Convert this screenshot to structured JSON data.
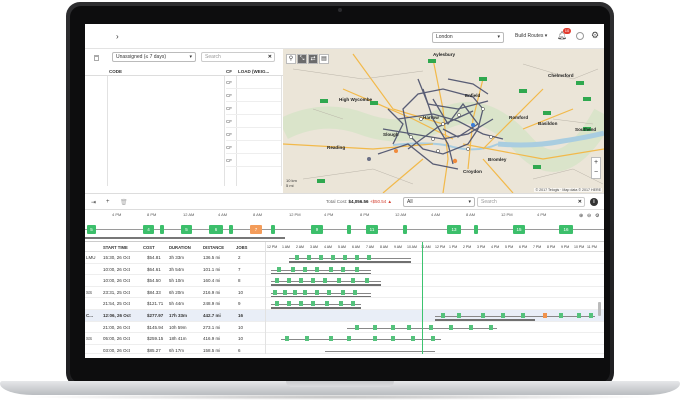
{
  "topbar": {
    "nav_arrow": "›",
    "city": "London",
    "build_routes": "Build Routes",
    "notifications": "10"
  },
  "left_panel": {
    "filter": "Unassigned (≤ 7 days)",
    "search_placeholder": "Search",
    "col_code": "CODE",
    "col_cf": "CF",
    "col_load": "LOAD (WEIG...",
    "cf_values": [
      "CF",
      "CF",
      "CF",
      "CF",
      "CF",
      "CF",
      "CF"
    ]
  },
  "map": {
    "labels": [
      {
        "name": "Aylesbury"
      },
      {
        "name": "High Wycombe"
      },
      {
        "name": "Harrow"
      },
      {
        "name": "Enfield"
      },
      {
        "name": "Romford"
      },
      {
        "name": "Slough"
      },
      {
        "name": "Reading"
      },
      {
        "name": "Croydon"
      },
      {
        "name": "Bromley"
      },
      {
        "name": "Southend"
      },
      {
        "name": "Chelmsford"
      },
      {
        "name": "Basildon"
      }
    ],
    "scale_km": "10 km",
    "scale_mi": "5 mi",
    "attribution": "© 2017 Telogis · Map data © 2017 HERE"
  },
  "toolbar": {
    "total_cost_label": "Total Cost:",
    "total_cost": "$4,056.56",
    "delta": "+$50.54 ▲",
    "filter": "All",
    "search_placeholder": "Search"
  },
  "overview": {
    "ticks": [
      "4 PM",
      "8 PM",
      "12 AM",
      "4 AM",
      "8 AM",
      "12 PM",
      "4 PM",
      "8 PM",
      "12 AM",
      "4 AM",
      "8 AM",
      "12 PM",
      "4 PM"
    ],
    "boxes": [
      "5",
      "4",
      "5",
      "6",
      "7",
      "9",
      "11",
      "13",
      "15",
      "16"
    ]
  },
  "grid": {
    "headers": [
      "START TIME",
      "COST",
      "DURATION",
      "DISTANCE",
      "JOBS"
    ],
    "time_ticks": [
      "12 PM",
      "1 AM",
      "2 AM",
      "3 AM",
      "4 AM",
      "5 AM",
      "6 AM",
      "7 AM",
      "8 AM",
      "9 AM",
      "10 AM",
      "11 AM",
      "12 PM",
      "1 PM",
      "2 PM",
      "3 PM",
      "4 PM",
      "5 PM",
      "6 PM",
      "7 PM",
      "8 PM",
      "9 PM",
      "10 PM",
      "11 PM"
    ],
    "rows": [
      {
        "id": "LMU",
        "start": "15:30, 26 Oct",
        "cost": "$54.81",
        "duration": "3h 33m",
        "distance": "136.5 mi",
        "jobs": "2"
      },
      {
        "id": "",
        "start": "10:00, 26 Oct",
        "cost": "$64.61",
        "duration": "3h 54m",
        "distance": "101.1 mi",
        "jobs": "7"
      },
      {
        "id": "",
        "start": "10:00, 26 Oct",
        "cost": "$54.50",
        "duration": "5h 10m",
        "distance": "160.4 mi",
        "jobs": "8"
      },
      {
        "id": "SS",
        "start": "23:31, 25 Oct",
        "cost": "$84.33",
        "duration": "6h 20m",
        "distance": "216.9 mi",
        "jobs": "10"
      },
      {
        "id": "",
        "start": "21:54, 25 Oct",
        "cost": "$121.71",
        "duration": "5h 44m",
        "distance": "248.9 mi",
        "jobs": "9"
      },
      {
        "id": "C...",
        "start": "12:06, 26 Oct",
        "cost": "$277.97",
        "duration": "17h 33m",
        "distance": "442.7 mi",
        "jobs": "16"
      },
      {
        "id": "",
        "start": "21:00, 26 Oct",
        "cost": "$145.94",
        "duration": "10h 59m",
        "distance": "273.1 mi",
        "jobs": "10"
      },
      {
        "id": "SS",
        "start": "05:00, 26 Oct",
        "cost": "$259.15",
        "duration": "18h 41m",
        "distance": "416.9 mi",
        "jobs": "10"
      },
      {
        "id": "",
        "start": "03:00, 26 Oct",
        "cost": "$85.27",
        "duration": "6h 17m",
        "distance": "158.5 mi",
        "jobs": "6"
      }
    ]
  }
}
